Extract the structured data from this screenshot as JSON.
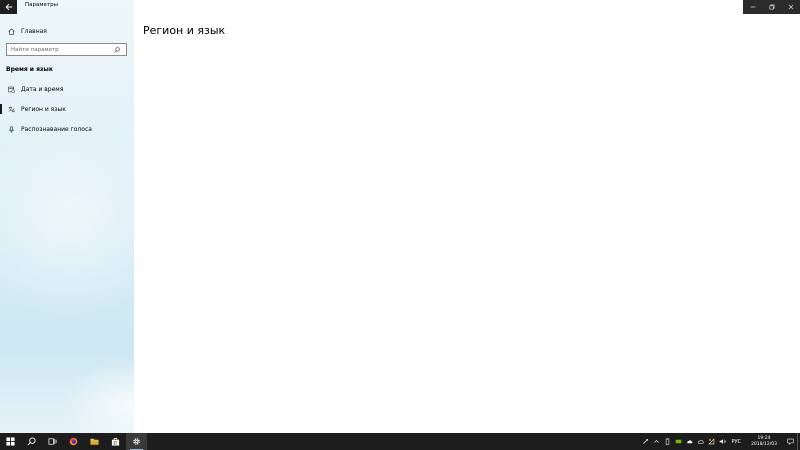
{
  "window": {
    "app_title": "Параметры",
    "page_title": "Регион и язык"
  },
  "sidebar": {
    "home_label": "Главная",
    "search": {
      "placeholder": "Найти параметр",
      "value": ""
    },
    "section_heading": "Время и язык",
    "items": [
      {
        "label": "Дата и время",
        "icon": "calendar-clock-icon",
        "selected": false
      },
      {
        "label": "Регион и язык",
        "icon": "language-icon",
        "selected": true
      },
      {
        "label": "Распознавание голоса",
        "icon": "microphone-icon",
        "selected": false
      }
    ]
  },
  "taskbar": {
    "apps": [
      "start-icon",
      "search-icon",
      "task-view-icon",
      "firefox-icon",
      "file-explorer-icon",
      "store-icon",
      "settings-icon"
    ],
    "language": "РУС",
    "time": "19:24",
    "date": "2018/12/03"
  },
  "colors": {
    "taskbar_bg": "#1d1d1d",
    "sidebar_bg": "#e3f2f9",
    "title_controls_bg": "#2b2b2b",
    "accent_running": "#9ab7d9"
  }
}
